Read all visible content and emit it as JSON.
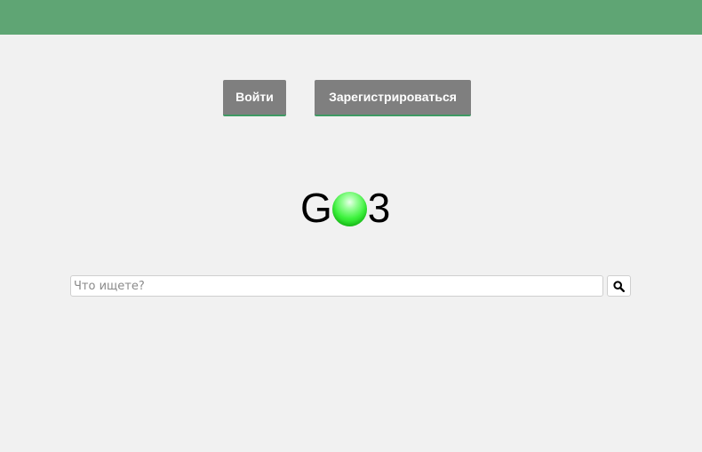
{
  "colors": {
    "header_bar": "#5fa574",
    "page_background": "#f1f1f1",
    "button_background": "#7f7f7f",
    "button_text": "#ffffff",
    "button_underline": "#3e9a63"
  },
  "auth": {
    "login_label": "Войти",
    "register_label": "Зарегистрироваться"
  },
  "logo": {
    "left_letter": "G",
    "right_letter": "3",
    "ball_icon": "green-ball-icon"
  },
  "search": {
    "placeholder": "Что ищете?",
    "value": "",
    "button_icon": "search-icon"
  }
}
